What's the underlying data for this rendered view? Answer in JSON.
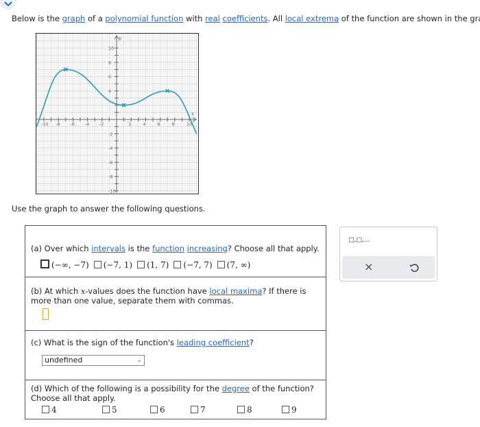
{
  "intro": {
    "t1": "Below is the ",
    "l1": "graph",
    "t2": " of a ",
    "l2": "polynomial function",
    "t3": " with ",
    "l3": "real",
    "t4": " ",
    "l4": "coefficients",
    "t5": ". All ",
    "l5": "local extrema",
    "t6": " of the function are shown in the graph."
  },
  "graph": {
    "y_axis_label": "y",
    "x_axis_label": "x",
    "x_ticks": [
      "-10",
      "-8",
      "-6",
      "-4",
      "-2",
      "2",
      "4",
      "6",
      "8",
      "10"
    ],
    "y_ticks": [
      "10",
      "8",
      "6",
      "4",
      "-2",
      "-4",
      "-6",
      "-8",
      "-10"
    ],
    "curve_color": "#2e9bb8"
  },
  "chart_data": {
    "type": "line",
    "x_range": [
      -10,
      10
    ],
    "y_range": [
      -10,
      10
    ],
    "grid": true,
    "points": [
      [
        -11,
        -1
      ],
      [
        -7,
        7
      ],
      [
        1,
        2
      ],
      [
        7,
        4
      ],
      [
        11,
        -2
      ]
    ],
    "extrema": [
      [
        -7,
        7
      ],
      [
        1,
        2
      ],
      [
        7,
        4
      ]
    ]
  },
  "use_text": "Use the graph to answer the following questions.",
  "qa": {
    "t1": "(a) Over which ",
    "l1": "intervals",
    "t2": " is the ",
    "l2": "function",
    "t3": " ",
    "l3": "increasing",
    "t4": "? Choose all that apply.",
    "options": [
      "(−∞, −7)",
      "(−7, 1)",
      "(1, 7)",
      "(−7, 7)",
      "(7, ∞)"
    ]
  },
  "qb": {
    "t1": "(b) At which ",
    "var": "x",
    "t2": "-values does the function have ",
    "l1": "local maxima",
    "t3": "? If there is more than one value, separate them with commas."
  },
  "qc": {
    "t1": "(c) What is the sign of the function's ",
    "l1": "leading coefficient",
    "t2": "?",
    "select_value": "undefined"
  },
  "qd": {
    "t1": "(d) Which of the following is a possibility for the ",
    "l1": "degree",
    "t2": " of the function? Choose all that apply.",
    "options": [
      "4",
      "5",
      "6",
      "7",
      "8",
      "9"
    ]
  },
  "tool": {
    "symbols": "□,□,...",
    "clear": "×"
  }
}
